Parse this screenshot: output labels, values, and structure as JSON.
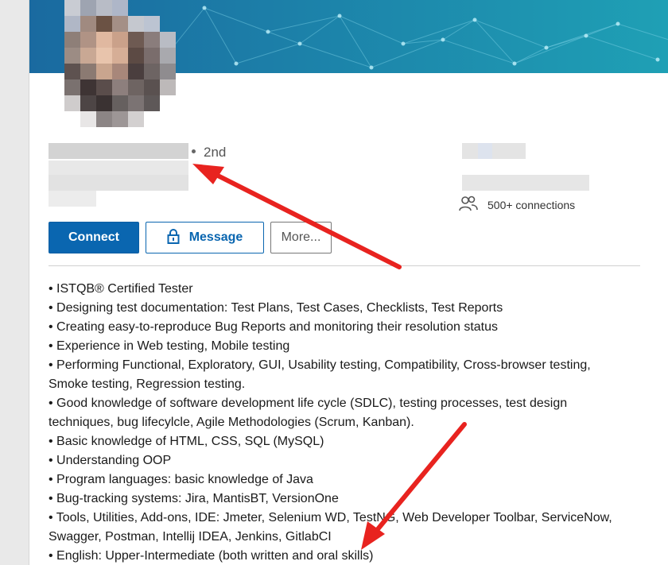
{
  "profile": {
    "degree": "2nd",
    "connections": "500+ connections"
  },
  "actions": {
    "connect_label": "Connect",
    "message_label": "Message",
    "more_label": "More..."
  },
  "about": {
    "lines": [
      "• ISTQB® Certified Tester",
      "• Designing test documentation: Test Plans, Test Cases, Checklists, Test Reports",
      "• Creating easy-to-reproduce Bug Reports and monitoring their resolution status",
      "• Experience in Web testing, Mobile testing",
      "• Performing Functional, Exploratory, GUI, Usability testing, Compatibility, Cross-browser testing,",
      "Smoke testing, Regression testing.",
      "• Good knowledge of software development life cycle (SDLC), testing processes, test design",
      "techniques, bug lifecylcle, Agile Methodologies (Scrum, Kanban).",
      "• Basic knowledge of HTML, CSS, SQL (MySQL)",
      "• Understanding OOP",
      "• Program languages: basic knowledge of Java",
      "• Bug-tracking systems: Jira, MantisBT, VersionOne",
      "• Tools, Utilities, Add-ons, IDE: Jmeter, Selenium WD, TestNG, Web Developer Toolbar, ServiceNow,",
      "Swagger, Postman, Intellij IDEA, Jenkins, GitlabCI",
      "• English: Upper-Intermediate (both written and oral skills)"
    ]
  },
  "icons": {
    "connections": "people-icon",
    "message": "lock-icon"
  },
  "colors": {
    "primary": "#0a66b0",
    "banner_start": "#1a6aa0",
    "banner_end": "#1fa0b5",
    "annotation_arrow": "#e8231f"
  }
}
